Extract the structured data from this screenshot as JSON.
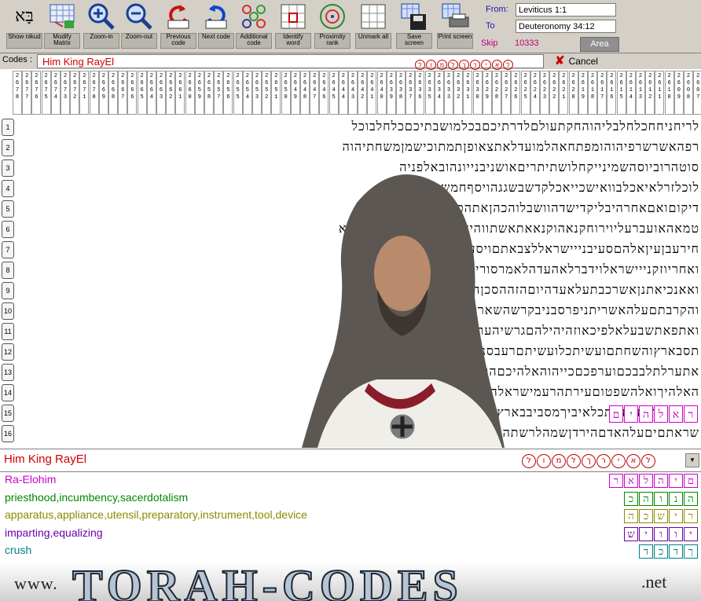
{
  "toolbar": {
    "buttons": [
      {
        "label": "Show nikud",
        "icon": "nikud-icon"
      },
      {
        "label": "Modify Matrix",
        "icon": "matrix-icon"
      },
      {
        "label": "Zoom-in",
        "icon": "zoom-in-icon"
      },
      {
        "label": "Zoom-out",
        "icon": "zoom-out-icon"
      },
      {
        "label": "Previous code",
        "icon": "previous-code-icon"
      },
      {
        "label": "Next code",
        "icon": "next-code-icon"
      },
      {
        "label": "Additional code",
        "icon": "additional-code-icon"
      },
      {
        "label": "Identify word",
        "icon": "identify-word-icon"
      },
      {
        "label": "Proximity rank",
        "icon": "proximity-icon"
      },
      {
        "label": "Unmark all",
        "icon": "unmark-icon"
      },
      {
        "label": "Save screen",
        "icon": "save-icon"
      },
      {
        "label": "Print screen",
        "icon": "print-icon"
      }
    ],
    "nikud_glyph": "בָּא",
    "from_label": "From:",
    "from_value": "Leviticus 1:1",
    "to_label": "To",
    "to_value": "Deuteronomy 34:12",
    "skip_label": "Skip",
    "skip_value": "10333",
    "area_label": "Area"
  },
  "codes": {
    "label": "Codes :",
    "value": "Him King RayEl",
    "hebrew_letters": [
      "ל",
      "ו",
      "מ",
      "ל",
      "ך",
      "ר",
      "י",
      "א",
      "ל"
    ],
    "cancel_label": "Cancel"
  },
  "header_numbers": [
    "2678",
    "2677",
    "2676",
    "2675",
    "2674",
    "2673",
    "2672",
    "2671",
    "2670",
    "2669",
    "2668",
    "2667",
    "2666",
    "2665",
    "2664",
    "2663",
    "2662",
    "2661",
    "2660",
    "2659",
    "2658",
    "2657",
    "2656",
    "2655",
    "2654",
    "2653",
    "2652",
    "2651",
    "2650",
    "2649",
    "2648",
    "2647",
    "2646",
    "2645",
    "2644",
    "2643",
    "2642",
    "2641",
    "2640",
    "2639",
    "2638",
    "2637",
    "2636",
    "2635",
    "2634",
    "2633",
    "2632",
    "2631",
    "2630",
    "2629",
    "2628",
    "2627",
    "2626",
    "2625",
    "2624",
    "2623",
    "2622",
    "2621",
    "2620",
    "2619",
    "2618",
    "2617",
    "2616",
    "2615",
    "2614",
    "2613",
    "2612",
    "2611",
    "2610",
    "2609",
    "2608",
    "2607"
  ],
  "rows": [
    {
      "num": "1",
      "text": "לריחניחחכלחלבליהוהחקתעולםלדרתיכםבכלמושבתיכםכלחלבוכל"
    },
    {
      "num": "2",
      "text": "רפהאשרשרפיהוהומפתחאהלמועדלאתצאופןתמתוכישמןמשחתיהוה"
    },
    {
      "num": "3",
      "text": "סוטהרוביוסהשמינייקחלושתיתריםאושניבנייונהובאלפניה"
    },
    {
      "num": "4",
      "text": "לוכלזרלאיאכלבוואישכייאכלקדשבשגגהויסףחמשיתעליוונתן"
    },
    {
      "num": "5",
      "text": "דיקוםואםאחרהיבליקדישדהוושבלוהכהןאתהכסףעלפיהשניםה"
    },
    {
      "num": "6",
      "text": "טמאהאועברעליוירוחקנאהוקנאאתאשתווהיאלאנטמאהוהביאהאישא"
    },
    {
      "num": "7",
      "text": "חירעבןעיןאלהםסעיבנייישראללצבאתםויסעויאמרםשהלחבבבןר"
    },
    {
      "num": "8",
      "text": "ואחריוזקנייישראלוידברלאהעדהלאמרסוריונאמעלאהליהאנשיםהר"
    },
    {
      "num": "9",
      "text": "ואאנכיאתנןאשרכבתעלאעדהיוםהזההסכןהסכנתילעשותל"
    },
    {
      "num": "10",
      "text": "והקרבתםעלהאשריתניפרסבניבקרשהשארילשנימכ"
    },
    {
      "num": "11",
      "text": "ואתפאתשבעלאלפיכאוזהיהילהםגרשיהעריםואתה"
    },
    {
      "num": "12",
      "text": "תסבארץוהשחתםועשיתכלועשיתםרעבסניהוהאלהיך"
    },
    {
      "num": "13",
      "text": "אתערלתלבבכםוערפכםכייהוהאלהיכםהואאלהיהאלהים"
    },
    {
      "num": "14",
      "text": "האלהיךואלהשפטוםעירתהרעמישראלהעםישמעוו"
    },
    {
      "num": "15",
      "text": "ראלהיםוהיהכהנתכלאיביךמסביבבארץאשריתה"
    },
    {
      "num": "16",
      "text": "שראתםיםעלהאדםהירדןשמהלרשתהויאמריהוה"
    }
  ],
  "bottom": {
    "title": "Him King RayEl",
    "title_letters": [
      "ל",
      "ו",
      "מ",
      "ל",
      "ך",
      "ר",
      "י",
      "א",
      "ל"
    ],
    "meanings": [
      {
        "text": "Ra-Elohim",
        "color": "#cc00cc",
        "word": [
          "ר",
          "א",
          "ל",
          "ה",
          "י",
          "ם"
        ]
      },
      {
        "text": "priesthood,incumbency,sacerdotalism",
        "color": "#008800",
        "word": [
          "כ",
          "ה",
          "ו",
          "נ",
          "ה"
        ]
      },
      {
        "text": "apparatus,appliance,utensil,preparatory,instrument,tool,device",
        "color": "#8a8a00",
        "word": [
          "ה",
          "כ",
          "ש",
          "י",
          "ר"
        ]
      },
      {
        "text": "imparting,equalizing",
        "color": "#6a00aa",
        "word": [
          "ש",
          "י",
          "ו",
          "ו",
          "י"
        ]
      },
      {
        "text": "crush",
        "color": "#008080",
        "word": [
          "ד",
          "כ",
          "ד",
          "ך"
        ]
      }
    ]
  },
  "banner": {
    "prefix": "www.",
    "main": "TORAH-CODES",
    "suffix": ".net"
  }
}
